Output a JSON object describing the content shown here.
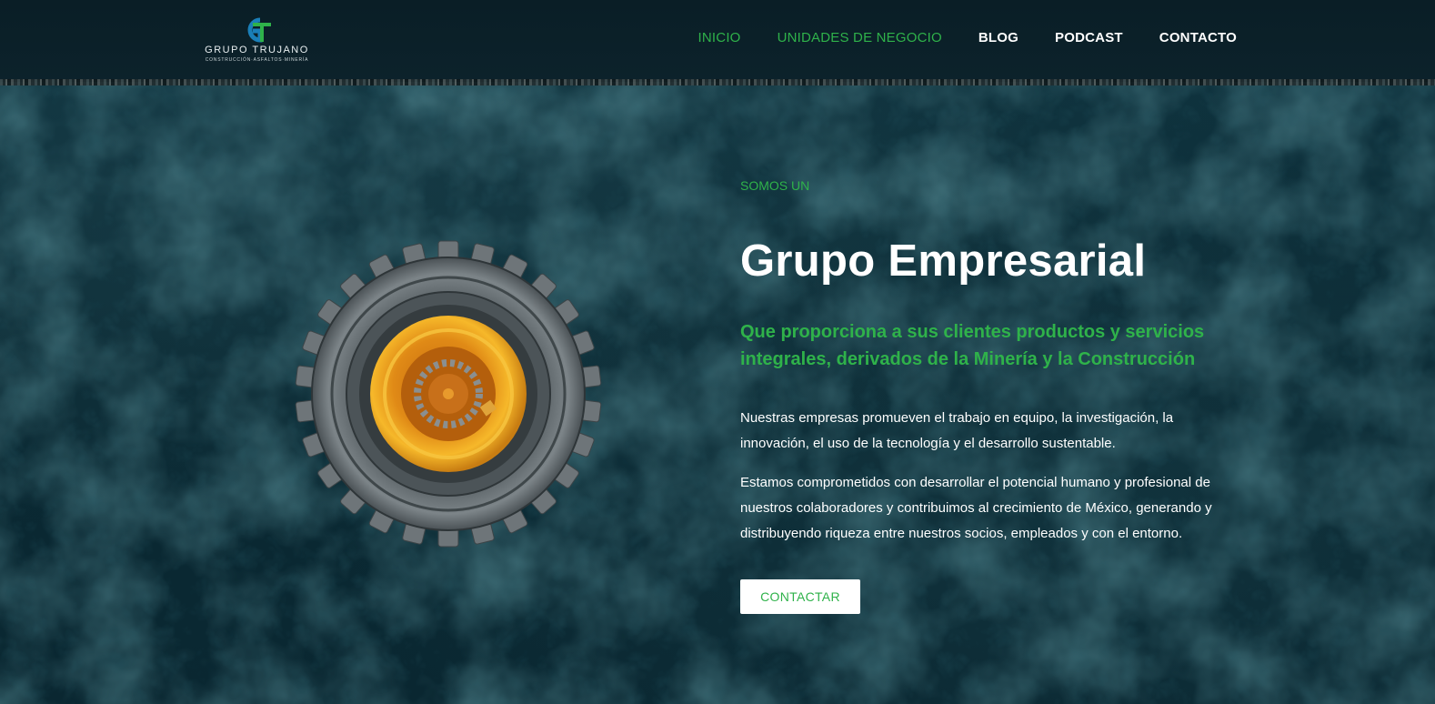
{
  "header": {
    "logo": {
      "name": "GRUPO TRUJANO",
      "tagline": "CONSTRUCCIÓN·ASFALTOS·MINERÍA",
      "mark_letters": "GT"
    },
    "nav": [
      {
        "label": "INICIO",
        "color": "#2fb24a"
      },
      {
        "label": "UNIDADES DE NEGOCIO",
        "color": "#2fb24a"
      },
      {
        "label": "BLOG",
        "color": "#ffffff"
      },
      {
        "label": "PODCAST",
        "color": "#ffffff"
      },
      {
        "label": "CONTACTO",
        "color": "#ffffff"
      }
    ]
  },
  "hero": {
    "eyebrow": "SOMOS UN",
    "title": "Grupo Empresarial",
    "subtitle": "Que proporciona a sus clientes productos y servicios integrales, derivados de la Minería y la Construcción",
    "paragraph_1": "Nuestras empresas promueven el trabajo en equipo, la investigación, la innovación, el uso de la tecnología y el desarrollo sustentable.",
    "paragraph_2": "Estamos comprometidos con desarrollar el potencial humano y profesional de nuestros colaboradores y contribuimos al crecimiento de México, generando y distribuyendo riqueza entre nuestros socios, empleados y con el entorno.",
    "cta_label": "CONTACTAR",
    "image": "tire-icon"
  },
  "colors": {
    "accent": "#2fb24a",
    "background": "#0d2a33",
    "header": "#0b2029",
    "rim": "#f0a81e"
  }
}
